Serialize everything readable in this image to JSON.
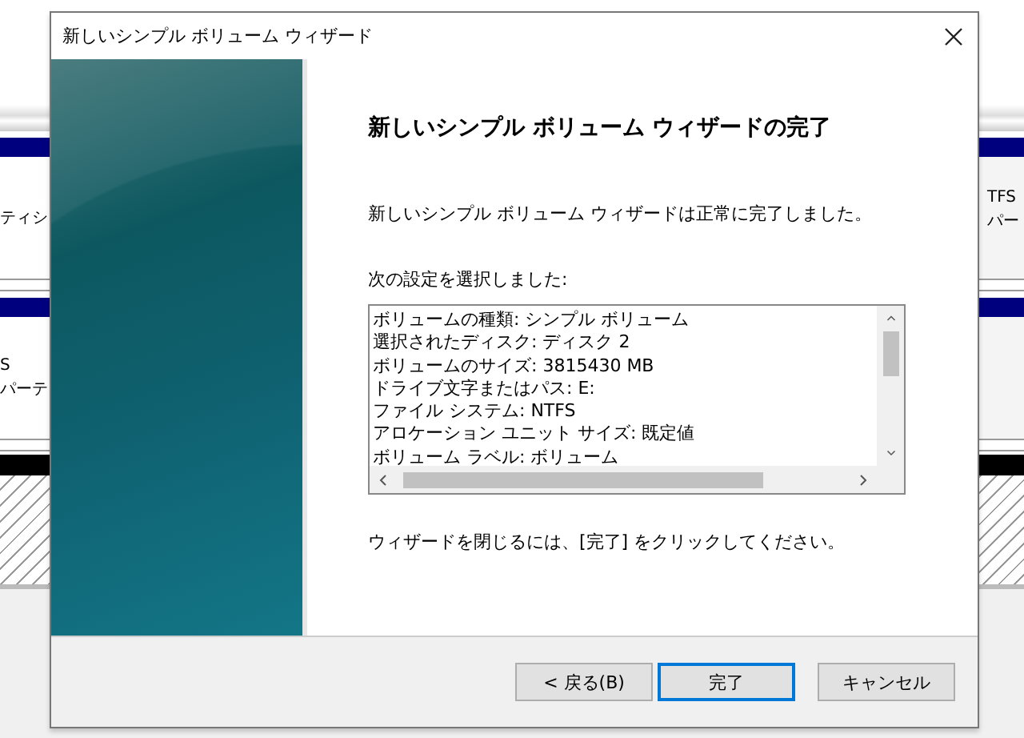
{
  "background": {
    "left_texts": [
      "ティシ",
      "S",
      "パーテ"
    ],
    "right_texts": [
      "TFS",
      "パー"
    ]
  },
  "window": {
    "title": "新しいシンプル ボリューム ウィザード"
  },
  "heading": "新しいシンプル ボリューム ウィザードの完了",
  "message": "新しいシンプル ボリューム ウィザードは正常に完了しました。",
  "settings_label": "次の設定を選択しました:",
  "settings": [
    "ボリュームの種類: シンプル ボリューム",
    "選択されたディスク: ディスク 2",
    "ボリュームのサイズ: 3815430 MB",
    "ドライブ文字またはパス: E:",
    "ファイル システム: NTFS",
    "アロケーション ユニット サイズ: 既定値",
    "ボリューム ラベル: ボリューム"
  ],
  "hint": "ウィザードを閉じるには、[完了] をクリックしてください。",
  "buttons": [
    {
      "label": "< 戻る(B)",
      "kind": "normal"
    },
    {
      "label": "完了",
      "kind": "default"
    },
    {
      "label": "キャンセル",
      "kind": "normal"
    }
  ]
}
